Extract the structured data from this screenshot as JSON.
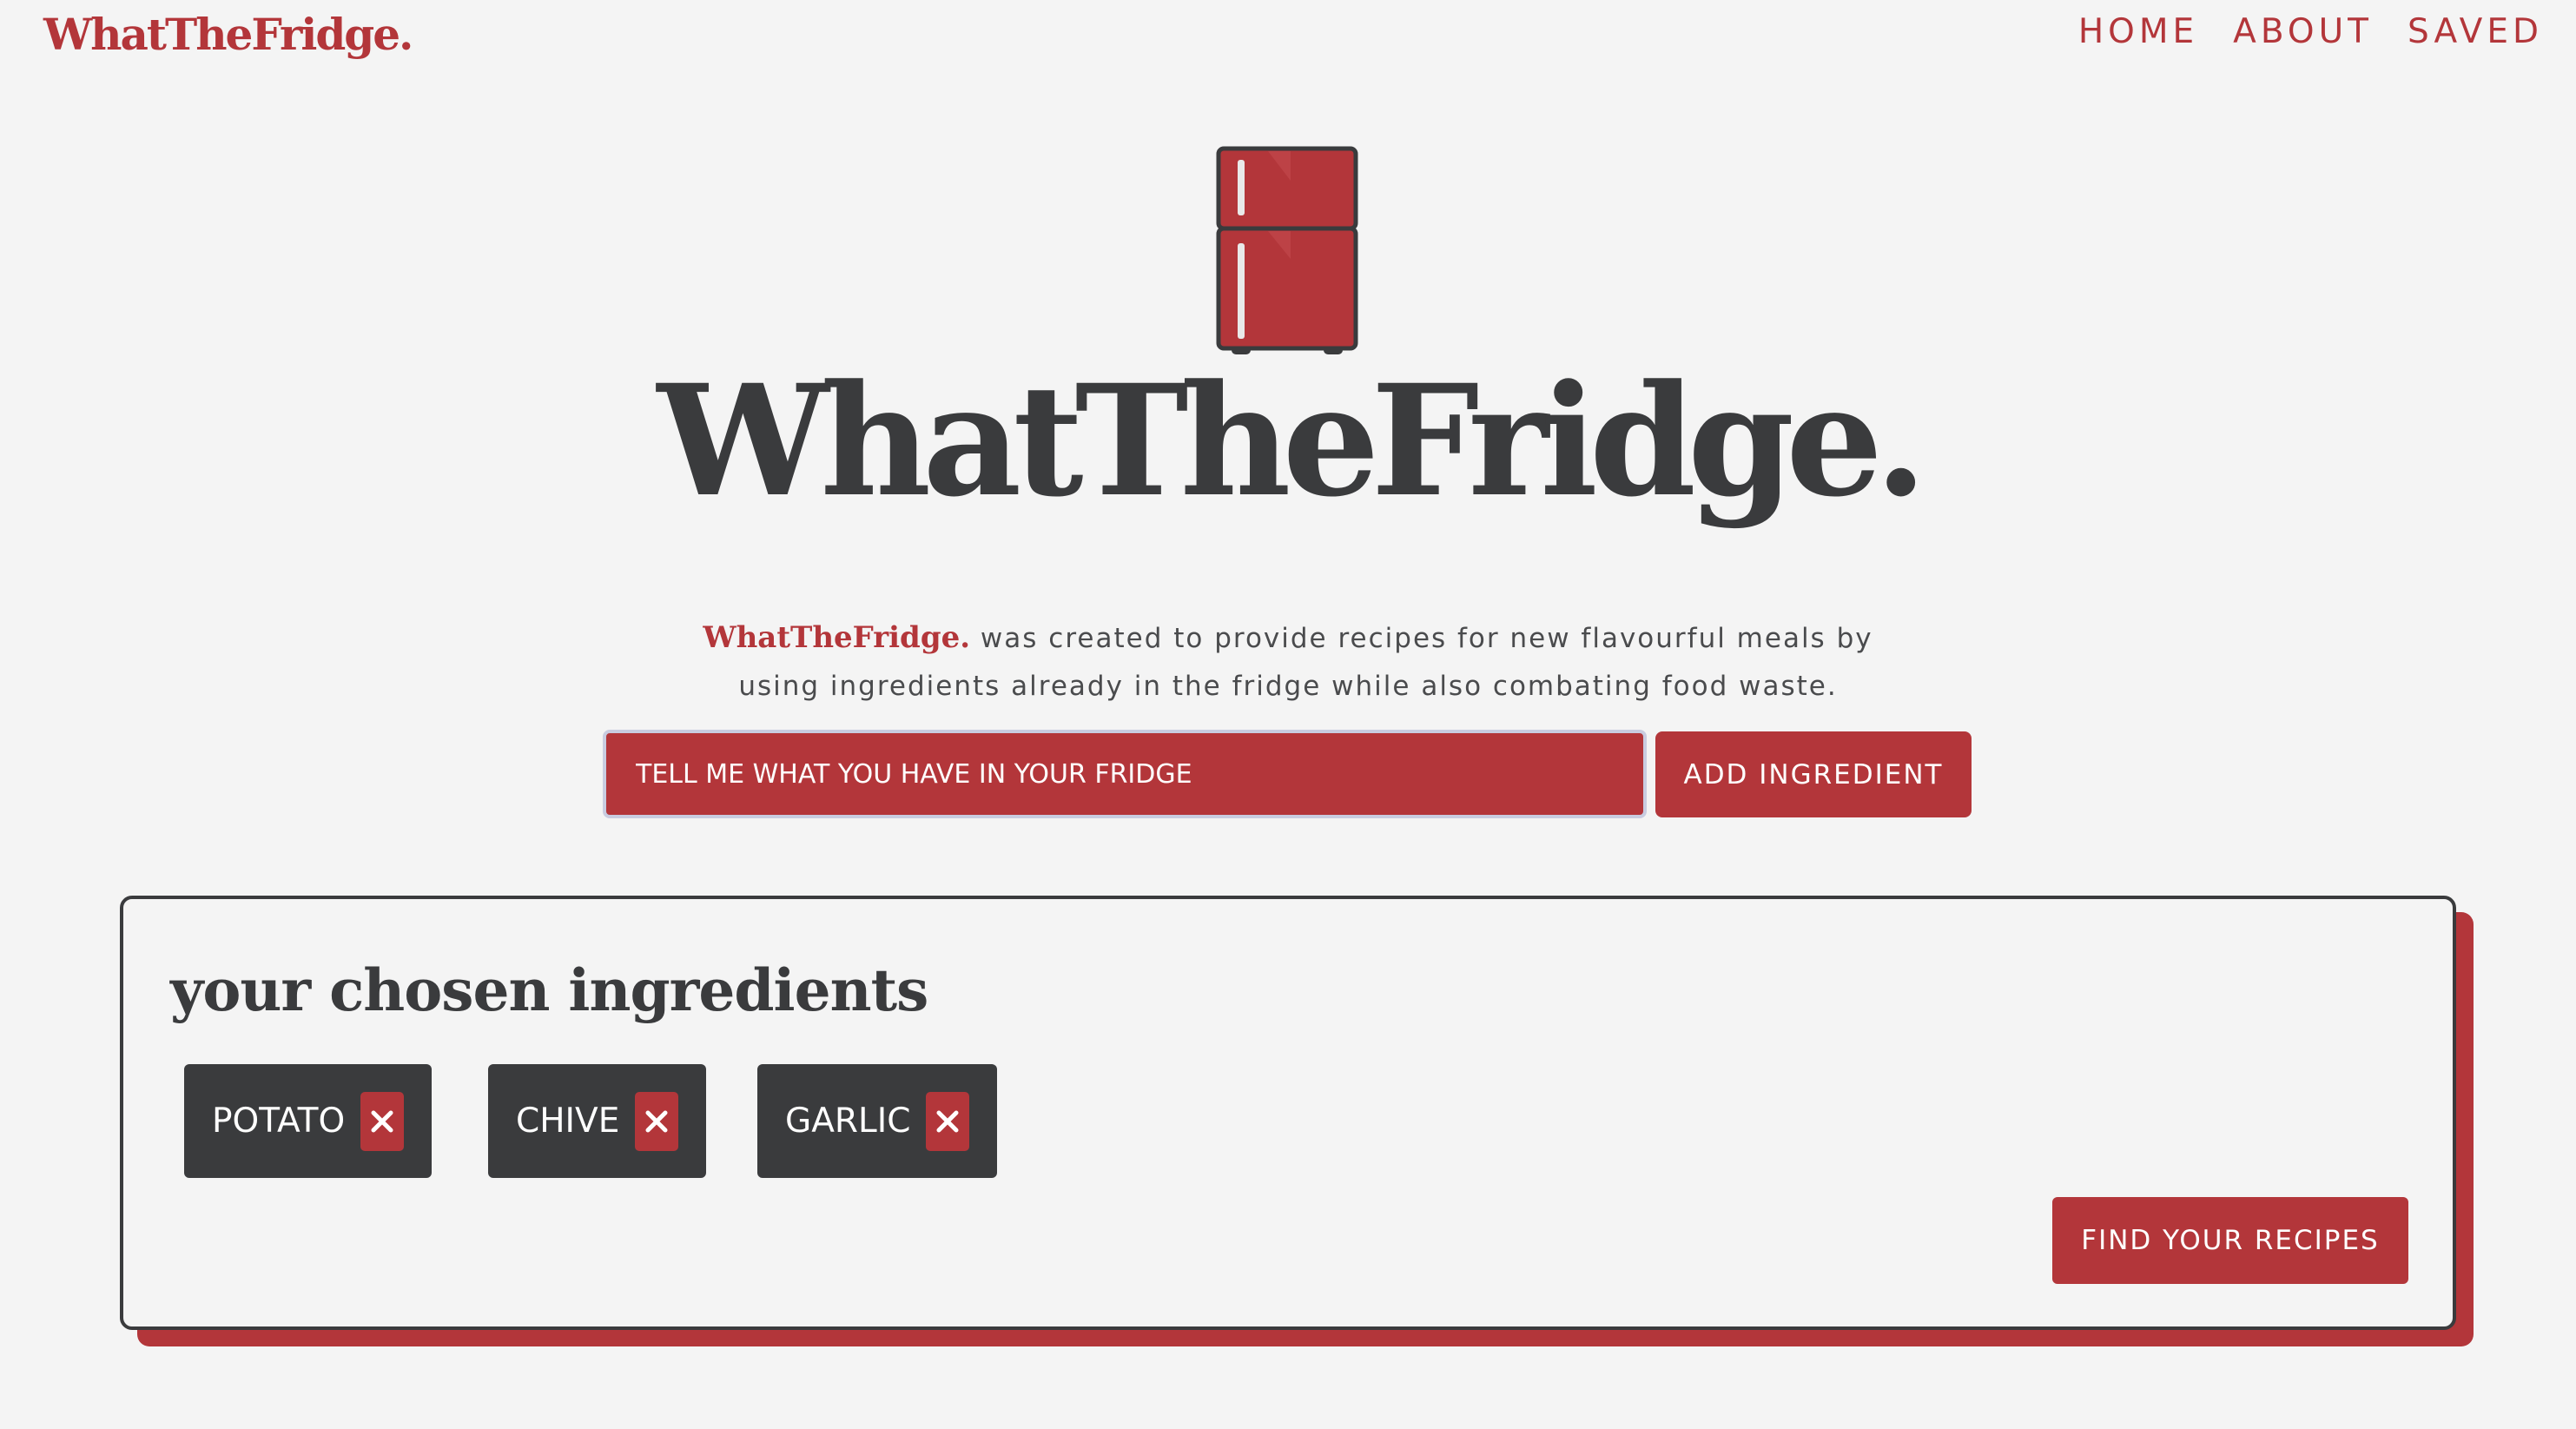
{
  "header": {
    "brand": "WhatTheFridge.",
    "nav": [
      {
        "label": "HOME"
      },
      {
        "label": "ABOUT"
      },
      {
        "label": "SAVED"
      }
    ]
  },
  "hero": {
    "icon": "fridge-icon",
    "title": "WhatTheFridge.",
    "description_brand": "WhatTheFridge.",
    "description_text": " was created to provide recipes for new flavourful meals by using ingredients already in the fridge while also combating food waste."
  },
  "search": {
    "placeholder": "TELL ME WHAT YOU HAVE IN YOUR FRIDGE",
    "value": "",
    "add_label": "ADD INGREDIENT"
  },
  "ingredients_panel": {
    "title": "your chosen ingredients",
    "items": [
      {
        "label": "POTATO",
        "remove_icon": "close-icon"
      },
      {
        "label": "CHIVE",
        "remove_icon": "close-icon"
      },
      {
        "label": "GARLIC",
        "remove_icon": "close-icon"
      }
    ],
    "find_label": "FIND YOUR RECIPES"
  },
  "colors": {
    "brand_red": "#b3363a",
    "dark": "#3a3b3d",
    "background": "#f4f4f4"
  }
}
